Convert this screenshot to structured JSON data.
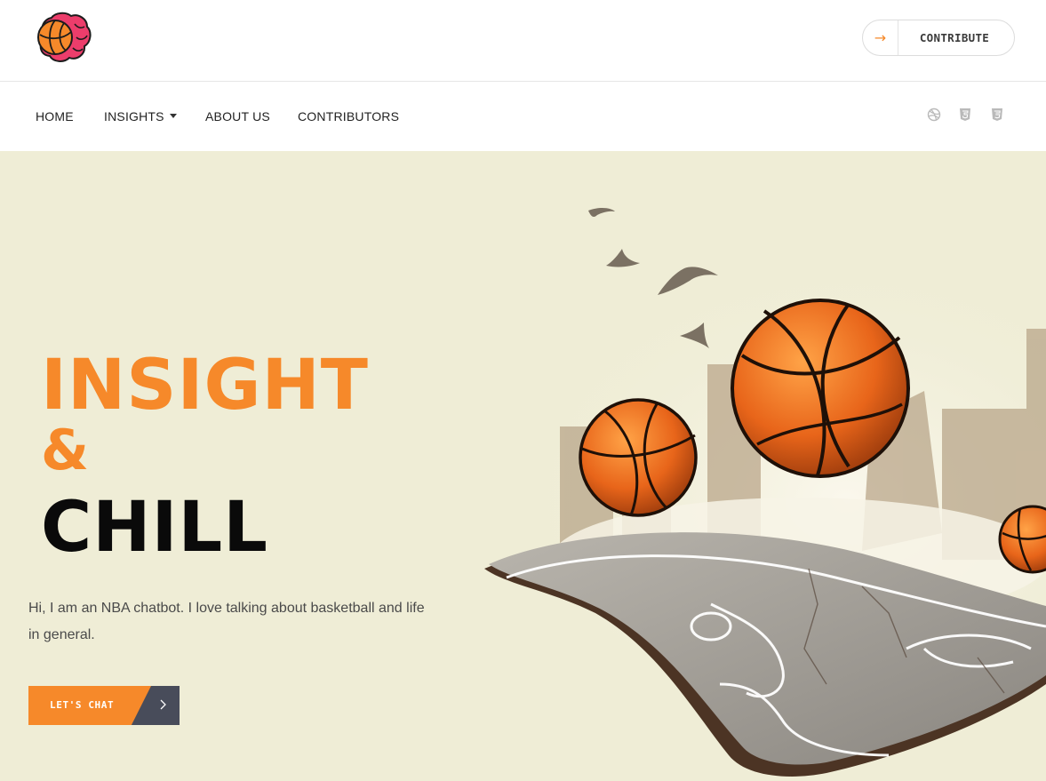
{
  "header": {
    "logo_icon": "basketball-brain-logo",
    "contribute": {
      "icon": "arrow-right-icon",
      "label": "CONTRIBUTE"
    }
  },
  "nav": {
    "items": [
      {
        "label": "HOME"
      },
      {
        "label": "INSIGHTS",
        "has_dropdown": true
      },
      {
        "label": "ABOUT US"
      },
      {
        "label": "CONTRIBUTORS"
      }
    ],
    "icons": [
      "dribbble-icon",
      "html5-icon",
      "css3-icon"
    ]
  },
  "hero": {
    "title_line1": "INSIGHT",
    "title_line2": "&",
    "title_line3": "CHILL",
    "intro": "Hi, I am an NBA chatbot. I love talking about basketball and life in general.",
    "cta_label": "LET'S CHAT",
    "cta_icon": "chevron-right-icon",
    "illustration": "basketballs-over-floating-court-illustration"
  },
  "colors": {
    "accent": "#f6892a",
    "hero_bg": "#efedd6",
    "dark": "#0a0a0a",
    "cta_dark": "#484c5a",
    "logo_pink": "#ec3d6b"
  }
}
